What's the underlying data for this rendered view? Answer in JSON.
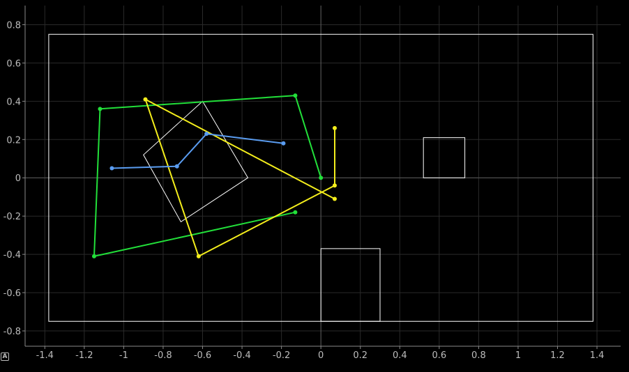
{
  "chart_data": {
    "type": "line",
    "xlim": [
      -1.5,
      1.52
    ],
    "ylim": [
      -0.88,
      0.9
    ],
    "grid": true,
    "axes_color": "#ffffff",
    "grid_color": "#2a2a2a",
    "xticks": [
      -1.4,
      -1.2,
      -1,
      -0.8,
      -0.6,
      -0.4,
      -0.2,
      0,
      0.2,
      0.4,
      0.6,
      0.8,
      1,
      1.2,
      1.4
    ],
    "yticks": [
      -0.8,
      -0.6,
      -0.4,
      -0.2,
      0,
      0.2,
      0.4,
      0.6,
      0.8
    ],
    "xtick_labels": [
      "-1.4",
      "-1.2",
      "-1",
      "-0.8",
      "-0.6",
      "-0.4",
      "-0.2",
      "0",
      "0.2",
      "0.4",
      "0.6",
      "0.8",
      "1",
      "1.2",
      "1.4"
    ],
    "ytick_labels": [
      "-0.8",
      "-0.6",
      "-0.4",
      "-0.2",
      "0",
      "0.2",
      "0.4",
      "0.6",
      "0.8"
    ],
    "shapes": [
      {
        "kind": "rect",
        "color": "#ffffff",
        "points": [
          [
            -1.38,
            0.75
          ],
          [
            1.38,
            0.75
          ],
          [
            1.38,
            -0.75
          ],
          [
            -1.38,
            -0.75
          ]
        ]
      },
      {
        "kind": "rect",
        "color": "#ffffff",
        "points": [
          [
            0.52,
            0.21
          ],
          [
            0.73,
            0.21
          ],
          [
            0.73,
            0.0
          ],
          [
            0.52,
            0.0
          ]
        ]
      },
      {
        "kind": "rect",
        "color": "#ffffff",
        "points": [
          [
            0.0,
            -0.37
          ],
          [
            0.3,
            -0.37
          ],
          [
            0.3,
            -0.75
          ],
          [
            0.0,
            -0.75
          ]
        ]
      },
      {
        "kind": "rect",
        "color": "#ffffff",
        "points": [
          [
            -0.6,
            0.4
          ],
          [
            -0.37,
            0.0
          ],
          [
            -0.71,
            -0.23
          ],
          [
            -0.9,
            0.12
          ]
        ]
      }
    ],
    "series": [
      {
        "color": "#22e03a",
        "points": [
          [
            -0.13,
            -0.18
          ],
          [
            -1.15,
            -0.41
          ],
          [
            -1.12,
            0.36
          ],
          [
            -0.13,
            0.43
          ],
          [
            0.0,
            0.0
          ]
        ]
      },
      {
        "color": "#f4ee1c",
        "points": [
          [
            0.07,
            0.26
          ],
          [
            0.07,
            -0.04
          ],
          [
            -0.62,
            -0.41
          ],
          [
            -0.89,
            0.41
          ],
          [
            0.07,
            -0.11
          ]
        ]
      },
      {
        "color": "#5a9cf0",
        "points": [
          [
            -1.06,
            0.05
          ],
          [
            -0.73,
            0.06
          ],
          [
            -0.58,
            0.23
          ],
          [
            -0.19,
            0.18
          ]
        ]
      }
    ]
  },
  "corner_badge": "A"
}
